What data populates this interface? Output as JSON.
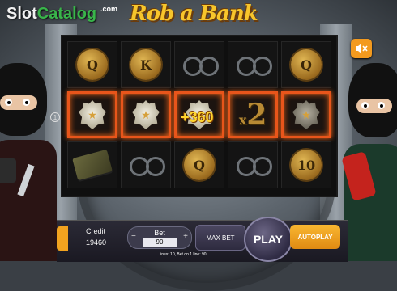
{
  "branding": {
    "slot": "Slot",
    "catalog": "Catalog",
    "com": ".com"
  },
  "game": {
    "title": "Rob a Bank"
  },
  "reels": [
    [
      {
        "symbol": "coin",
        "label": "Q"
      },
      {
        "symbol": "badge",
        "win": true
      },
      {
        "symbol": "money"
      }
    ],
    [
      {
        "symbol": "coin",
        "label": "K"
      },
      {
        "symbol": "badge",
        "win": true
      },
      {
        "symbol": "handcuffs"
      }
    ],
    [
      {
        "symbol": "handcuffs"
      },
      {
        "symbol": "badge",
        "win": true
      },
      {
        "symbol": "coin",
        "label": "Q"
      }
    ],
    [
      {
        "symbol": "handcuffs"
      },
      {
        "symbol": "multiplier",
        "win": true
      },
      {
        "symbol": "handcuffs"
      }
    ],
    [
      {
        "symbol": "coin",
        "label": "Q"
      },
      {
        "symbol": "badge-dark",
        "win": true
      },
      {
        "symbol": "coin",
        "label": "10"
      }
    ]
  ],
  "win": {
    "amount": "+360",
    "multiplier_x": "x",
    "multiplier_n": "2"
  },
  "payline_marker": "1",
  "controls": {
    "credit_label": "Credit",
    "credit_value": "19460",
    "bet_label": "Bet",
    "bet_value": "90",
    "bet_minus": "−",
    "bet_plus": "+",
    "max_bet": "MAX BET",
    "play": "PLAY",
    "autoplay": "AUTOPLAY",
    "lines_info": "lines: 10,   Bet on 1 line: 90"
  },
  "colors": {
    "accent": "#f39a1f",
    "win_border": "#e8551b"
  }
}
